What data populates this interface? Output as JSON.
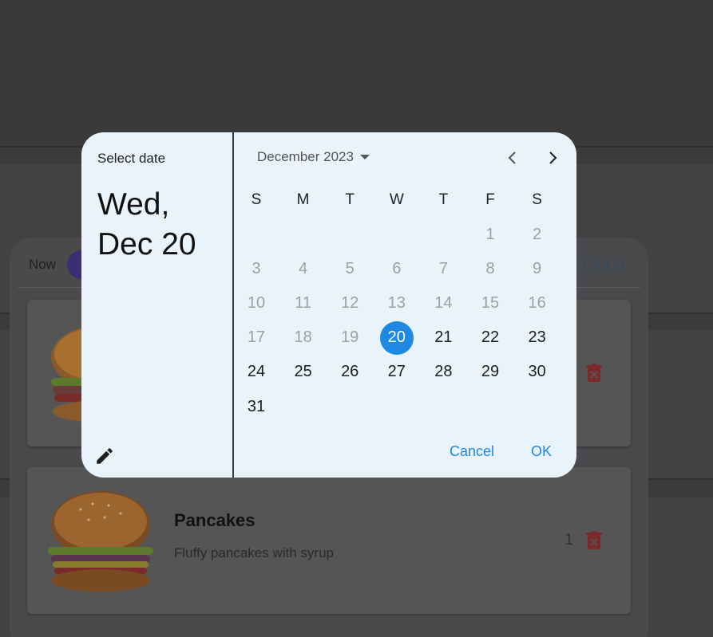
{
  "background": {
    "now_label": "Now",
    "currency_label": "Taka",
    "items": [
      {
        "title": "",
        "description": "",
        "quantity": ""
      },
      {
        "title": "Pancakes",
        "description": "Fluffy pancakes with syrup",
        "quantity": "1"
      }
    ]
  },
  "dialog": {
    "select_label": "Select date",
    "headline_line1": "Wed,",
    "headline_line2": "Dec 20",
    "month_label": "December 2023",
    "weekdays": [
      "S",
      "M",
      "T",
      "W",
      "T",
      "F",
      "S"
    ],
    "first_weekday_index": 5,
    "days_in_month": 31,
    "selected_day": 20,
    "enabled_from_day": 20,
    "cancel_label": "Cancel",
    "ok_label": "OK"
  },
  "colors": {
    "accent": "#1e88e5",
    "dialog_bg": "#e8f3fc"
  }
}
